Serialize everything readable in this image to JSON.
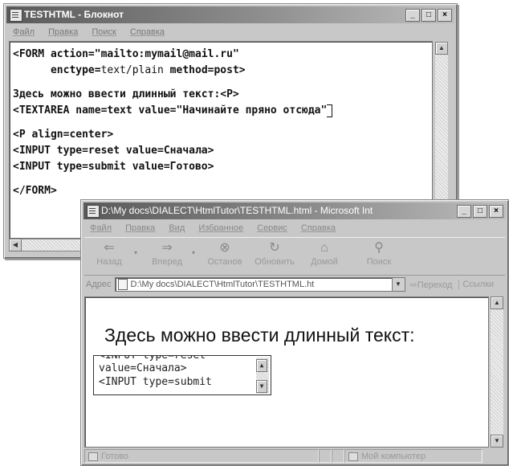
{
  "notepad": {
    "title": "TESTHTML - Блокнот",
    "menu": [
      "Файл",
      "Правка",
      "Поиск",
      "Справка"
    ],
    "lines": {
      "l1a": "<FORM ",
      "l1b": "action=",
      "l1c": "\"mailto:mymail@mail.ru\"",
      "l2a": "      enctype=",
      "l2b": "text/plain",
      "l2c": " method=post>",
      "l3a": "Здесь можно ввести длинный текст:",
      "l3b": "<P>",
      "l4a": "<TEXTAREA name=text value=",
      "l4b": "\"Начинайте пряно отсюда\"",
      "l5": "<P align=center>",
      "l6": "<INPUT type=reset value=Сначала>",
      "l7": "<INPUT type=submit value=Готово>",
      "l8": "</FORM>"
    }
  },
  "ie": {
    "title": "D:\\My docs\\DIALECT\\HtmlTutor\\TESTHTML.html - Microsoft Int",
    "menu": [
      "Файл",
      "Правка",
      "Вид",
      "Избранное",
      "Сервис",
      "Справка"
    ],
    "toolbar": {
      "back": "Назад",
      "forward": "Вперед",
      "stop": "Останов",
      "refresh": "Обновить",
      "home": "Домой",
      "search": "Поиск"
    },
    "address": {
      "label": "Адрес",
      "value": "D:\\My docs\\DIALECT\\HtmlTutor\\TESTHTML.ht",
      "go": "Переход",
      "links": "Ссылки"
    },
    "content": {
      "heading": "Здесь можно ввести длинный текст:",
      "textarea_lines": [
        "<INPUT type=reset",
        "value=Сначала>",
        "<INPUT type=submit"
      ]
    },
    "status": {
      "left": "Готово",
      "zone": "Мой компьютер"
    }
  }
}
